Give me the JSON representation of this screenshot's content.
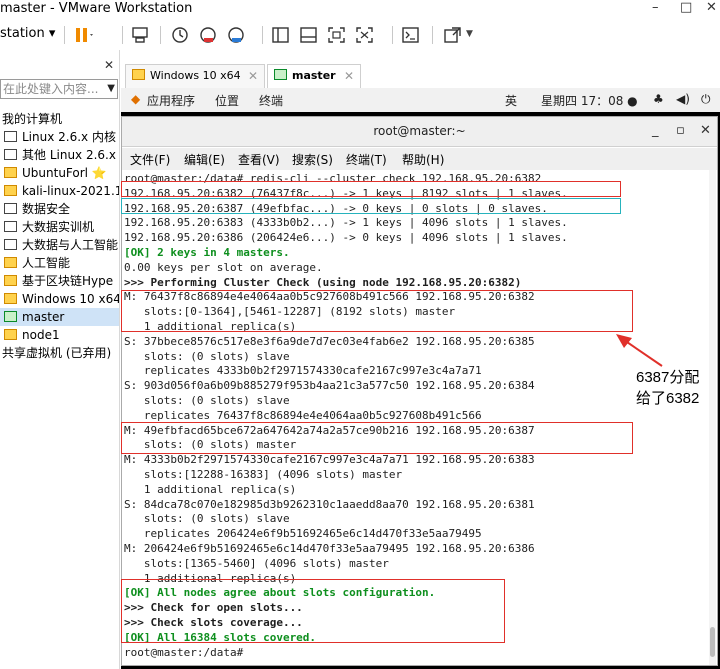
{
  "window": {
    "title": "master - VMware Workstation",
    "minimize": "–",
    "maximize": "□",
    "close": "✕"
  },
  "toolbar": {
    "menu_label": "station ▾",
    "icons": [
      "pause-icon",
      "send-ctrl-alt-del-icon",
      "snapshot-icon",
      "revert-snapshot-icon",
      "snapshot-manager-icon",
      "console-view-icon",
      "fit-guest-icon",
      "full-screen-icon",
      "unity-icon",
      "terminal-icon",
      "stretch-icon"
    ]
  },
  "library": {
    "search_placeholder": "在此处键入内容...",
    "items": [
      {
        "label": "我的计算机",
        "kind": "header"
      },
      {
        "label": "Linux 2.6.x 内核",
        "kind": "vm"
      },
      {
        "label": "其他 Linux 2.6.x",
        "kind": "vm"
      },
      {
        "label": "UbuntuForl ⭐",
        "kind": "vm-fav"
      },
      {
        "label": "kali-linux-2021.1",
        "kind": "vm-fav"
      },
      {
        "label": "数据安全",
        "kind": "vm"
      },
      {
        "label": "大数据实训机",
        "kind": "vm"
      },
      {
        "label": "大数据与人工智能",
        "kind": "vm"
      },
      {
        "label": "人工智能",
        "kind": "vm-fav"
      },
      {
        "label": "基于区块链Hype",
        "kind": "vm-fav"
      },
      {
        "label": "Windows 10 x64",
        "kind": "vm-fav"
      },
      {
        "label": "master",
        "kind": "vm-run",
        "selected": true
      },
      {
        "label": "node1",
        "kind": "vm-fav"
      },
      {
        "label": "共享虚拟机 (已弃用)",
        "kind": "header"
      }
    ]
  },
  "tabs": [
    {
      "label": "Windows 10 x64",
      "active": false
    },
    {
      "label": "master",
      "active": true
    }
  ],
  "gnome": {
    "apps": "应用程序",
    "places": "位置",
    "terminal": "终端",
    "ime": "英",
    "clock": "星期四 17：08 ●"
  },
  "terminal": {
    "title": "root@master:~",
    "menu": [
      "文件(F)",
      "编辑(E)",
      "查看(V)",
      "搜索(S)",
      "终端(T)",
      "帮助(H)"
    ],
    "lines": [
      "root@master:/data# redis-cli --cluster check 192.168.95.20:6382",
      "192.168.95.20:6382 (76437f8c...) -> 1 keys | 8192 slots | 1 slaves.",
      "192.168.95.20:6387 (49efbfac...) -> 0 keys | 0 slots | 0 slaves.",
      "192.168.95.20:6383 (4333b0b2...) -> 1 keys | 4096 slots | 1 slaves.",
      "192.168.95.20:6386 (206424e6...) -> 0 keys | 4096 slots | 1 slaves.",
      "[OK] 2 keys in 4 masters.",
      "0.00 keys per slot on average.",
      ">>> Performing Cluster Check (using node 192.168.95.20:6382)",
      "M: 76437f8c86894e4e4064aa0b5c927608b491c566 192.168.95.20:6382",
      "   slots:[0-1364],[5461-12287] (8192 slots) master",
      "   1 additional replica(s)",
      "S: 37bbece8576c517e8e3f6a9de7d7ec03e4fab6e2 192.168.95.20:6385",
      "   slots: (0 slots) slave",
      "   replicates 4333b0b2f2971574330cafe2167c997e3c4a7a71",
      "S: 903d056f0a6b09b885279f953b4aa21c3a577c50 192.168.95.20:6384",
      "   slots: (0 slots) slave",
      "   replicates 76437f8c86894e4e4064aa0b5c927608b491c566",
      "M: 49efbfacd65bce672a647642a74a2a57ce90b216 192.168.95.20:6387",
      "   slots: (0 slots) master",
      "M: 4333b0b2f2971574330cafe2167c997e3c4a7a71 192.168.95.20:6383",
      "   slots:[12288-16383] (4096 slots) master",
      "   1 additional replica(s)",
      "S: 84dca78c070e182985d3b9262310c1aaedd8aa70 192.168.95.20:6381",
      "   slots: (0 slots) slave",
      "   replicates 206424e6f9b51692465e6c14d470f33e5aa79495",
      "M: 206424e6f9b51692465e6c14d470f33e5aa79495 192.168.95.20:6386",
      "   slots:[1365-5460] (4096 slots) master",
      "   1 additional replica(s)",
      "[OK] All nodes agree about slots configuration.",
      ">>> Check for open slots...",
      ">>> Check slots coverage...",
      "[OK] All 16384 slots covered.",
      "root@master:/data# "
    ]
  },
  "annotation": {
    "note_line1": "6387分配",
    "note_line2": "给了6382"
  }
}
